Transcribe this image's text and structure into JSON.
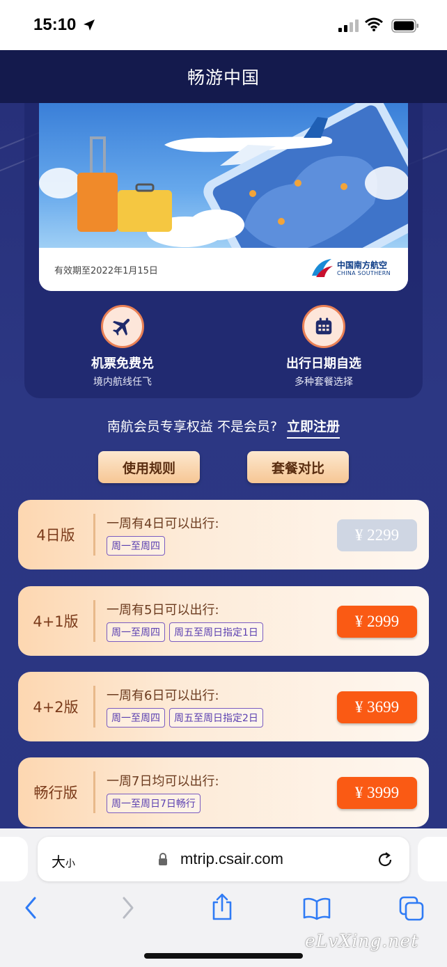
{
  "status_bar": {
    "time": "15:10"
  },
  "header": {
    "title": "畅游中国"
  },
  "banner": {
    "validity": "有效期至2022年1月15日",
    "airline_cn": "中国南方航空",
    "airline_en": "CHINA SOUTHERN"
  },
  "features": [
    {
      "title": "机票免费兑",
      "subtitle": "境内航线任飞",
      "icon": "airplane-icon"
    },
    {
      "title": "出行日期自选",
      "subtitle": "多种套餐选择",
      "icon": "calendar-icon"
    }
  ],
  "member": {
    "text": "南航会员专享权益 不是会员?",
    "register": "立即注册"
  },
  "buttons": {
    "rules": "使用规则",
    "compare": "套餐对比"
  },
  "plans": [
    {
      "name": "4日版",
      "desc": "一周有4日可以出行:",
      "tags": [
        "周一至周四"
      ],
      "price": "¥ 2299",
      "available": false
    },
    {
      "name": "4+1版",
      "desc": "一周有5日可以出行:",
      "tags": [
        "周一至周四",
        "周五至周日指定1日"
      ],
      "price": "¥ 2999",
      "available": true
    },
    {
      "name": "4+2版",
      "desc": "一周有6日可以出行:",
      "tags": [
        "周一至周四",
        "周五至周日指定2日"
      ],
      "price": "¥ 3699",
      "available": true
    },
    {
      "name": "畅行版",
      "desc": "一周7日均可以出行:",
      "tags": [
        "周一至周日7日畅行"
      ],
      "price": "¥ 3999",
      "available": true
    }
  ],
  "browser": {
    "text_size_big": "大",
    "text_size_small": "小",
    "url": "mtrip.csair.com"
  },
  "watermark": "eLvXing.net",
  "colors": {
    "accent_orange": "#fa5a14",
    "header_navy": "#141a4d",
    "page_blue": "#2b3582"
  }
}
